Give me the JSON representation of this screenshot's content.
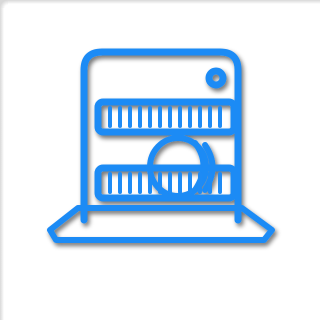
{
  "icon": {
    "name": "dishwasher-icon",
    "color": "#1e8bf5",
    "shadow_color": "#0a3a6a"
  }
}
